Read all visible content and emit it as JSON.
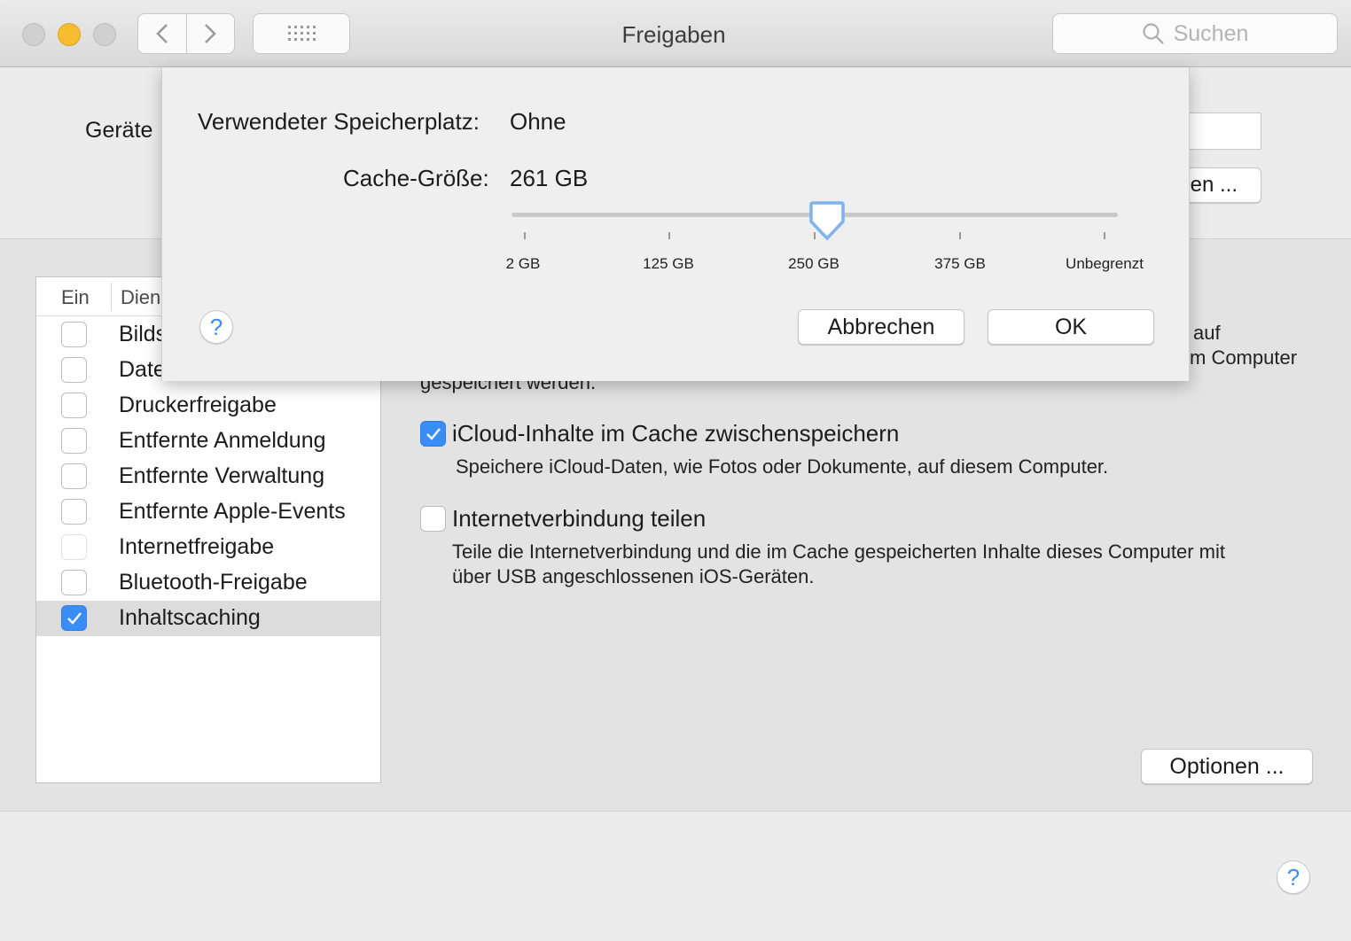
{
  "window": {
    "title": "Freigaben",
    "search_placeholder": "Suchen"
  },
  "device": {
    "label": "Gerätename:",
    "visible_label": "Geräte",
    "edit_button_visible": "en ..."
  },
  "service_list": {
    "header_on": "Ein",
    "header_service": "Dien",
    "items": [
      {
        "label": "Bilds",
        "checked": false
      },
      {
        "label": "Date",
        "checked": false
      },
      {
        "label": "Druckerfreigabe",
        "checked": false
      },
      {
        "label": "Entfernte Anmeldung",
        "checked": false
      },
      {
        "label": "Entfernte Verwaltung",
        "checked": false
      },
      {
        "label": "Entfernte Apple-Events",
        "checked": false
      },
      {
        "label": "Internetfreigabe",
        "checked": false
      },
      {
        "label": "Bluetooth-Freigabe",
        "checked": false
      },
      {
        "label": "Inhaltscaching",
        "checked": true
      }
    ]
  },
  "detail": {
    "partial_line1": "auf",
    "partial_line2": "m Computer",
    "partial_line3": "gespeichert werden.",
    "icloud_option": {
      "label": "iCloud-Inhalte im Cache zwischenspeichern",
      "description": "Speichere iCloud-Daten, wie Fotos oder Dokumente, auf diesem Computer.",
      "checked": true
    },
    "internet_option": {
      "label": "Internetverbindung teilen",
      "description_line1": "Teile die Internetverbindung und die im Cache gespeicherten Inhalte dieses Computer mit",
      "description_line2": "über USB angeschlossenen iOS-Geräten.",
      "checked": false
    },
    "options_button": "Optionen ...",
    "help": "?"
  },
  "sheet": {
    "used_label": "Verwendeter Speicherplatz:",
    "used_value": "Ohne",
    "cache_label": "Cache-Größe:",
    "cache_value": "261 GB",
    "slider_ticks": [
      "2 GB",
      "125 GB",
      "250 GB",
      "375 GB",
      "Unbegrenzt"
    ],
    "slider_value_fraction": 0.52,
    "help": "?",
    "cancel_button": "Abbrechen",
    "ok_button": "OK"
  },
  "colors": {
    "accent": "#3b8df6",
    "minimize": "#f6be2f"
  }
}
